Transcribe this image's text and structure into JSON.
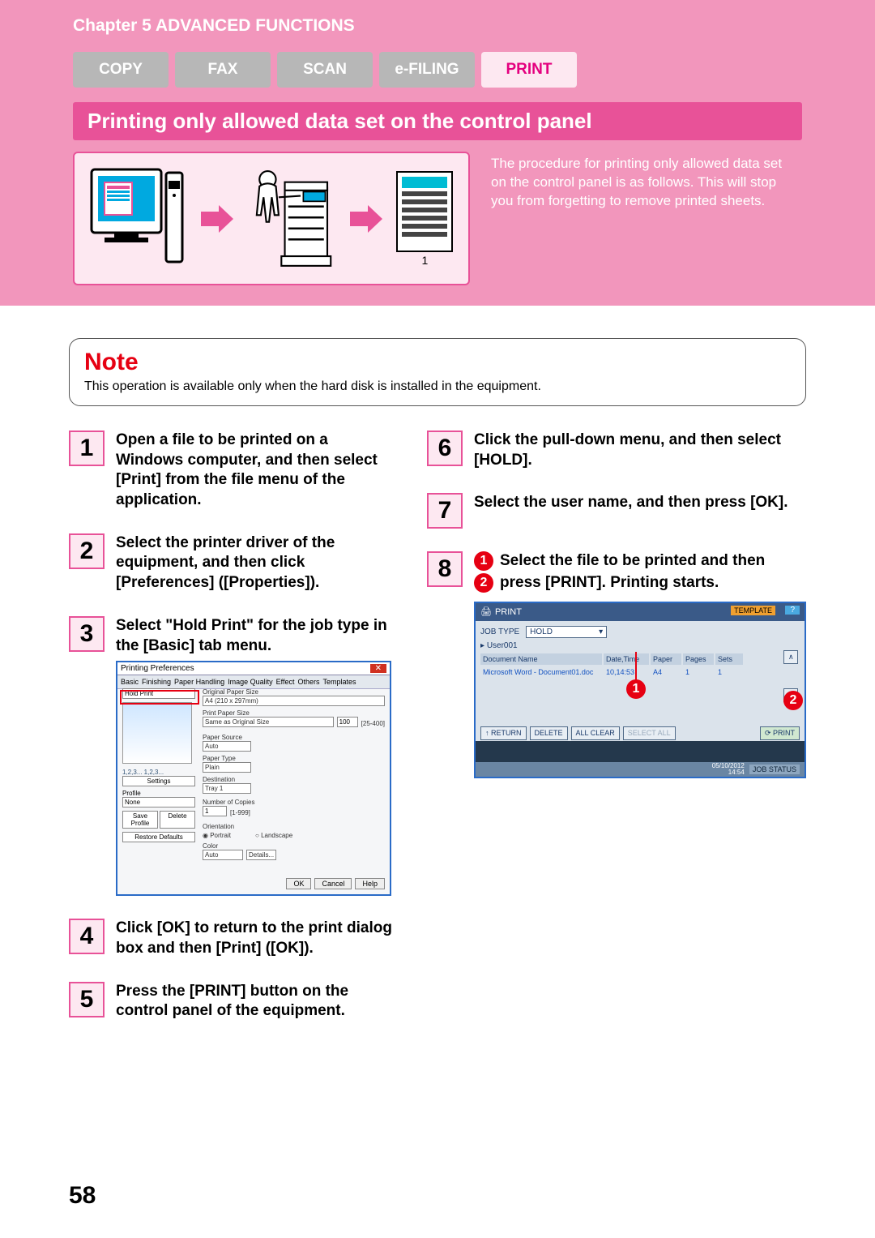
{
  "chapter": "Chapter 5 ADVANCED FUNCTIONS",
  "tabs": {
    "copy": "COPY",
    "fax": "FAX",
    "scan": "SCAN",
    "efiling": "e-FILING",
    "print": "PRINT"
  },
  "section_title": "Printing only allowed data set on the control panel",
  "diagram": {
    "caption_1": "1",
    "description": "The procedure for printing only allowed data set on the control panel is as follows. This will stop you from forgetting to remove printed sheets."
  },
  "note": {
    "title": "Note",
    "text": "This operation is available only when the hard disk is installed in the equipment."
  },
  "steps": {
    "s1": "Open a file to be printed on a Windows computer, and then select [Print] from the file menu of the application.",
    "s2": "Select the printer driver of the equipment, and then click [Preferences] ([Properties]).",
    "s3": "Select \"Hold Print\" for the job type in the [Basic] tab menu.",
    "s4": "Click [OK] to return to the print dialog box and then [Print] ([OK]).",
    "s5": "Press the [PRINT] button on the control panel of the equipment.",
    "s6": "Click the pull-down menu, and then select [HOLD].",
    "s7": "Select the user name, and then press [OK].",
    "s8a": "Select the file to be printed and then",
    "s8b": "press [PRINT]. Printing starts."
  },
  "screenshot1": {
    "window_title": "Printing Preferences",
    "tabs": [
      "Basic",
      "Finishing",
      "Paper Handling",
      "Image Quality",
      "Effect",
      "Others",
      "Templates"
    ],
    "job_type": "Hold Print",
    "paper_size_label": "Original Paper Size",
    "paper_size": "A4 (210 x 297mm)",
    "print_paper_label": "Print Paper Size",
    "same_as": "Same as Original Size",
    "scale": "100",
    "range": "[25-400]",
    "paper_source_label": "Paper Source",
    "paper_source": "Auto",
    "paper_type_label": "Paper Type",
    "paper_type": "Plain",
    "destination_label": "Destination",
    "destination": "Tray 1",
    "copies_label": "Number of Copies",
    "copies_value": "1",
    "copies_range": "[1-999]",
    "orientation_label": "Orientation",
    "orient_portrait": "Portrait",
    "orient_landscape": "Landscape",
    "color_label": "Color",
    "color_value": "Auto",
    "details": "Details...",
    "settings_btn": "Settings",
    "profile_label": "Profile",
    "profile_value": "None",
    "save_profile": "Save Profile",
    "delete": "Delete",
    "restore": "Restore Defaults",
    "ok": "OK",
    "cancel": "Cancel",
    "help": "Help"
  },
  "screenshot2": {
    "title": "PRINT",
    "template": "TEMPLATE",
    "help": "?",
    "job_type_label": "JOB TYPE",
    "job_type_value": "HOLD",
    "user": "User001",
    "col_doc": "Document Name",
    "col_dt": "Date,Time",
    "col_paper": "Paper",
    "col_pages": "Pages",
    "col_sets": "Sets",
    "doc_name": "Microsoft Word - Document01.doc",
    "doc_dt": "10,14:53",
    "doc_paper": "A4",
    "doc_pages": "1",
    "doc_sets": "1",
    "btn_return": "RETURN",
    "btn_delete": "DELETE",
    "btn_allclear": "ALL CLEAR",
    "btn_selectall": "SELECT ALL",
    "btn_print": "PRINT",
    "timestamp": "05/10/2012\n14:54",
    "jobstatus": "JOB STATUS"
  },
  "page_number": "58"
}
